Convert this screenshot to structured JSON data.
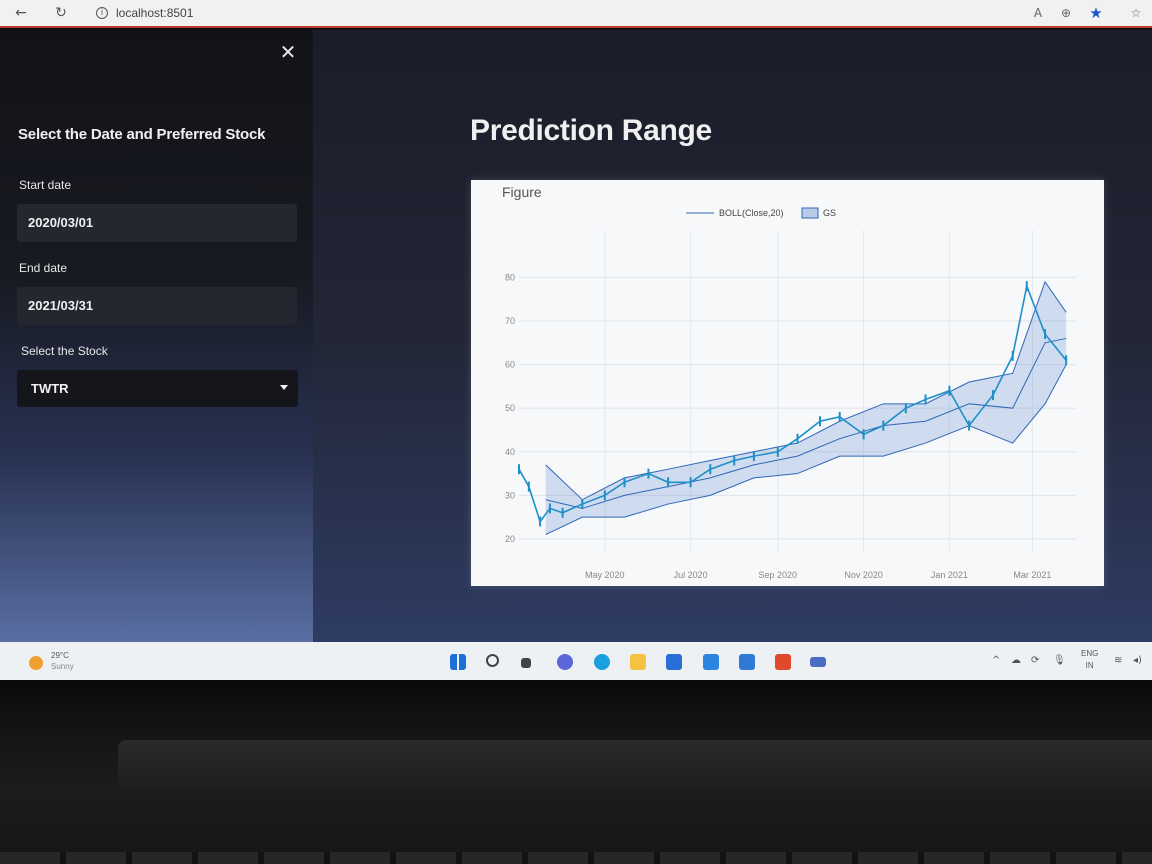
{
  "browser": {
    "url": "localhost:8501",
    "back_icon": "arrow-left-icon",
    "refresh_icon": "refresh-icon",
    "read_aloud_label": "A"
  },
  "sidebar": {
    "title": "Select the Date and Preferred Stock",
    "start_date_label": "Start date",
    "start_date_value": "2020/03/01",
    "end_date_label": "End date",
    "end_date_value": "2021/03/31",
    "stock_label": "Select the Stock",
    "stock_value": "TWTR"
  },
  "main": {
    "title": "Prediction Range"
  },
  "chart_data": {
    "type": "line",
    "title": "Figure",
    "legend": [
      "BOLL(Close,20)",
      "GS"
    ],
    "legend_position": "top",
    "grid": true,
    "x_tick_labels": [
      "May 2020",
      "Jul 2020",
      "Sep 2020",
      "Nov 2020",
      "Jan 2021",
      "Mar 2021"
    ],
    "y_tick_labels": [
      "20",
      "30",
      "40",
      "50",
      "60",
      "70",
      "80"
    ],
    "ylim": [
      17,
      84
    ],
    "xlim": [
      "2020-03-01",
      "2021-04-01"
    ],
    "series": [
      {
        "name": "GS",
        "x": [
          "2020-03-01",
          "2020-03-08",
          "2020-03-16",
          "2020-03-23",
          "2020-04-01",
          "2020-04-15",
          "2020-05-01",
          "2020-05-15",
          "2020-06-01",
          "2020-06-15",
          "2020-07-01",
          "2020-07-15",
          "2020-08-01",
          "2020-08-15",
          "2020-09-01",
          "2020-09-15",
          "2020-10-01",
          "2020-10-15",
          "2020-11-01",
          "2020-11-15",
          "2020-12-01",
          "2020-12-15",
          "2021-01-01",
          "2021-01-15",
          "2021-02-01",
          "2021-02-15",
          "2021-02-25",
          "2021-03-10",
          "2021-03-25"
        ],
        "y": [
          36,
          32,
          24,
          27,
          26,
          28,
          30,
          33,
          35,
          33,
          33,
          36,
          38,
          39,
          40,
          43,
          47,
          48,
          44,
          46,
          50,
          52,
          54,
          46,
          53,
          62,
          78,
          67,
          61
        ]
      },
      {
        "name": "BOLL(Close,20) mid",
        "x": [
          "2020-03-20",
          "2020-04-15",
          "2020-05-15",
          "2020-06-15",
          "2020-07-15",
          "2020-08-15",
          "2020-09-15",
          "2020-10-15",
          "2020-11-15",
          "2020-12-15",
          "2021-01-15",
          "2021-02-15",
          "2021-03-10",
          "2021-03-25"
        ],
        "y": [
          29,
          27,
          30,
          32,
          34,
          37,
          39,
          43,
          46,
          47,
          51,
          50,
          65,
          66
        ]
      },
      {
        "name": "BOLL(Close,20) upper",
        "x": [
          "2020-03-20",
          "2020-04-15",
          "2020-05-15",
          "2020-06-15",
          "2020-07-15",
          "2020-08-15",
          "2020-09-15",
          "2020-10-15",
          "2020-11-15",
          "2020-12-15",
          "2021-01-15",
          "2021-02-15",
          "2021-03-10",
          "2021-03-25"
        ],
        "y": [
          37,
          29,
          34,
          36,
          38,
          40,
          42,
          47,
          51,
          51,
          56,
          58,
          79,
          72
        ]
      },
      {
        "name": "BOLL(Close,20) lower",
        "x": [
          "2020-03-20",
          "2020-04-15",
          "2020-05-15",
          "2020-06-15",
          "2020-07-15",
          "2020-08-15",
          "2020-09-15",
          "2020-10-15",
          "2020-11-15",
          "2020-12-15",
          "2021-01-15",
          "2021-02-15",
          "2021-03-10",
          "2021-03-25"
        ],
        "y": [
          21,
          25,
          25,
          28,
          30,
          34,
          35,
          39,
          39,
          42,
          46,
          42,
          51,
          60
        ]
      }
    ]
  },
  "taskbar": {
    "temperature": "29°C",
    "condition": "Sunny",
    "lang_top": "ENG",
    "lang_bottom": "IN"
  }
}
